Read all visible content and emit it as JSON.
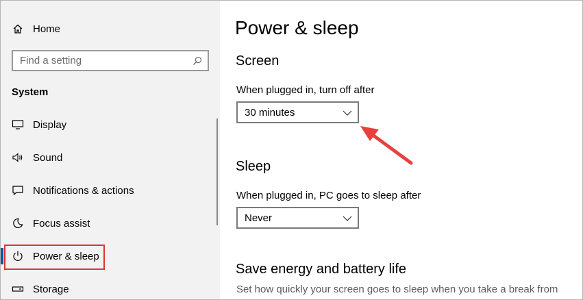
{
  "sidebar": {
    "home_label": "Home",
    "search_placeholder": "Find a setting",
    "section": "System",
    "items": [
      {
        "label": "Display",
        "icon": "display-icon"
      },
      {
        "label": "Sound",
        "icon": "sound-icon"
      },
      {
        "label": "Notifications & actions",
        "icon": "notifications-icon"
      },
      {
        "label": "Focus assist",
        "icon": "focus-assist-icon"
      },
      {
        "label": "Power & sleep",
        "icon": "power-icon"
      },
      {
        "label": "Storage",
        "icon": "storage-icon"
      }
    ]
  },
  "main": {
    "title": "Power & sleep",
    "screen": {
      "heading": "Screen",
      "label": "When plugged in, turn off after",
      "value": "30 minutes"
    },
    "sleep": {
      "heading": "Sleep",
      "label": "When plugged in, PC goes to sleep after",
      "value": "Never"
    },
    "save_energy": {
      "heading": "Save energy and battery life",
      "description": "Set how quickly your screen goes to sleep when you take a break from"
    }
  },
  "colors": {
    "accent": "#005a9e",
    "highlight": "#e03232",
    "arrow": "#e8413d"
  }
}
